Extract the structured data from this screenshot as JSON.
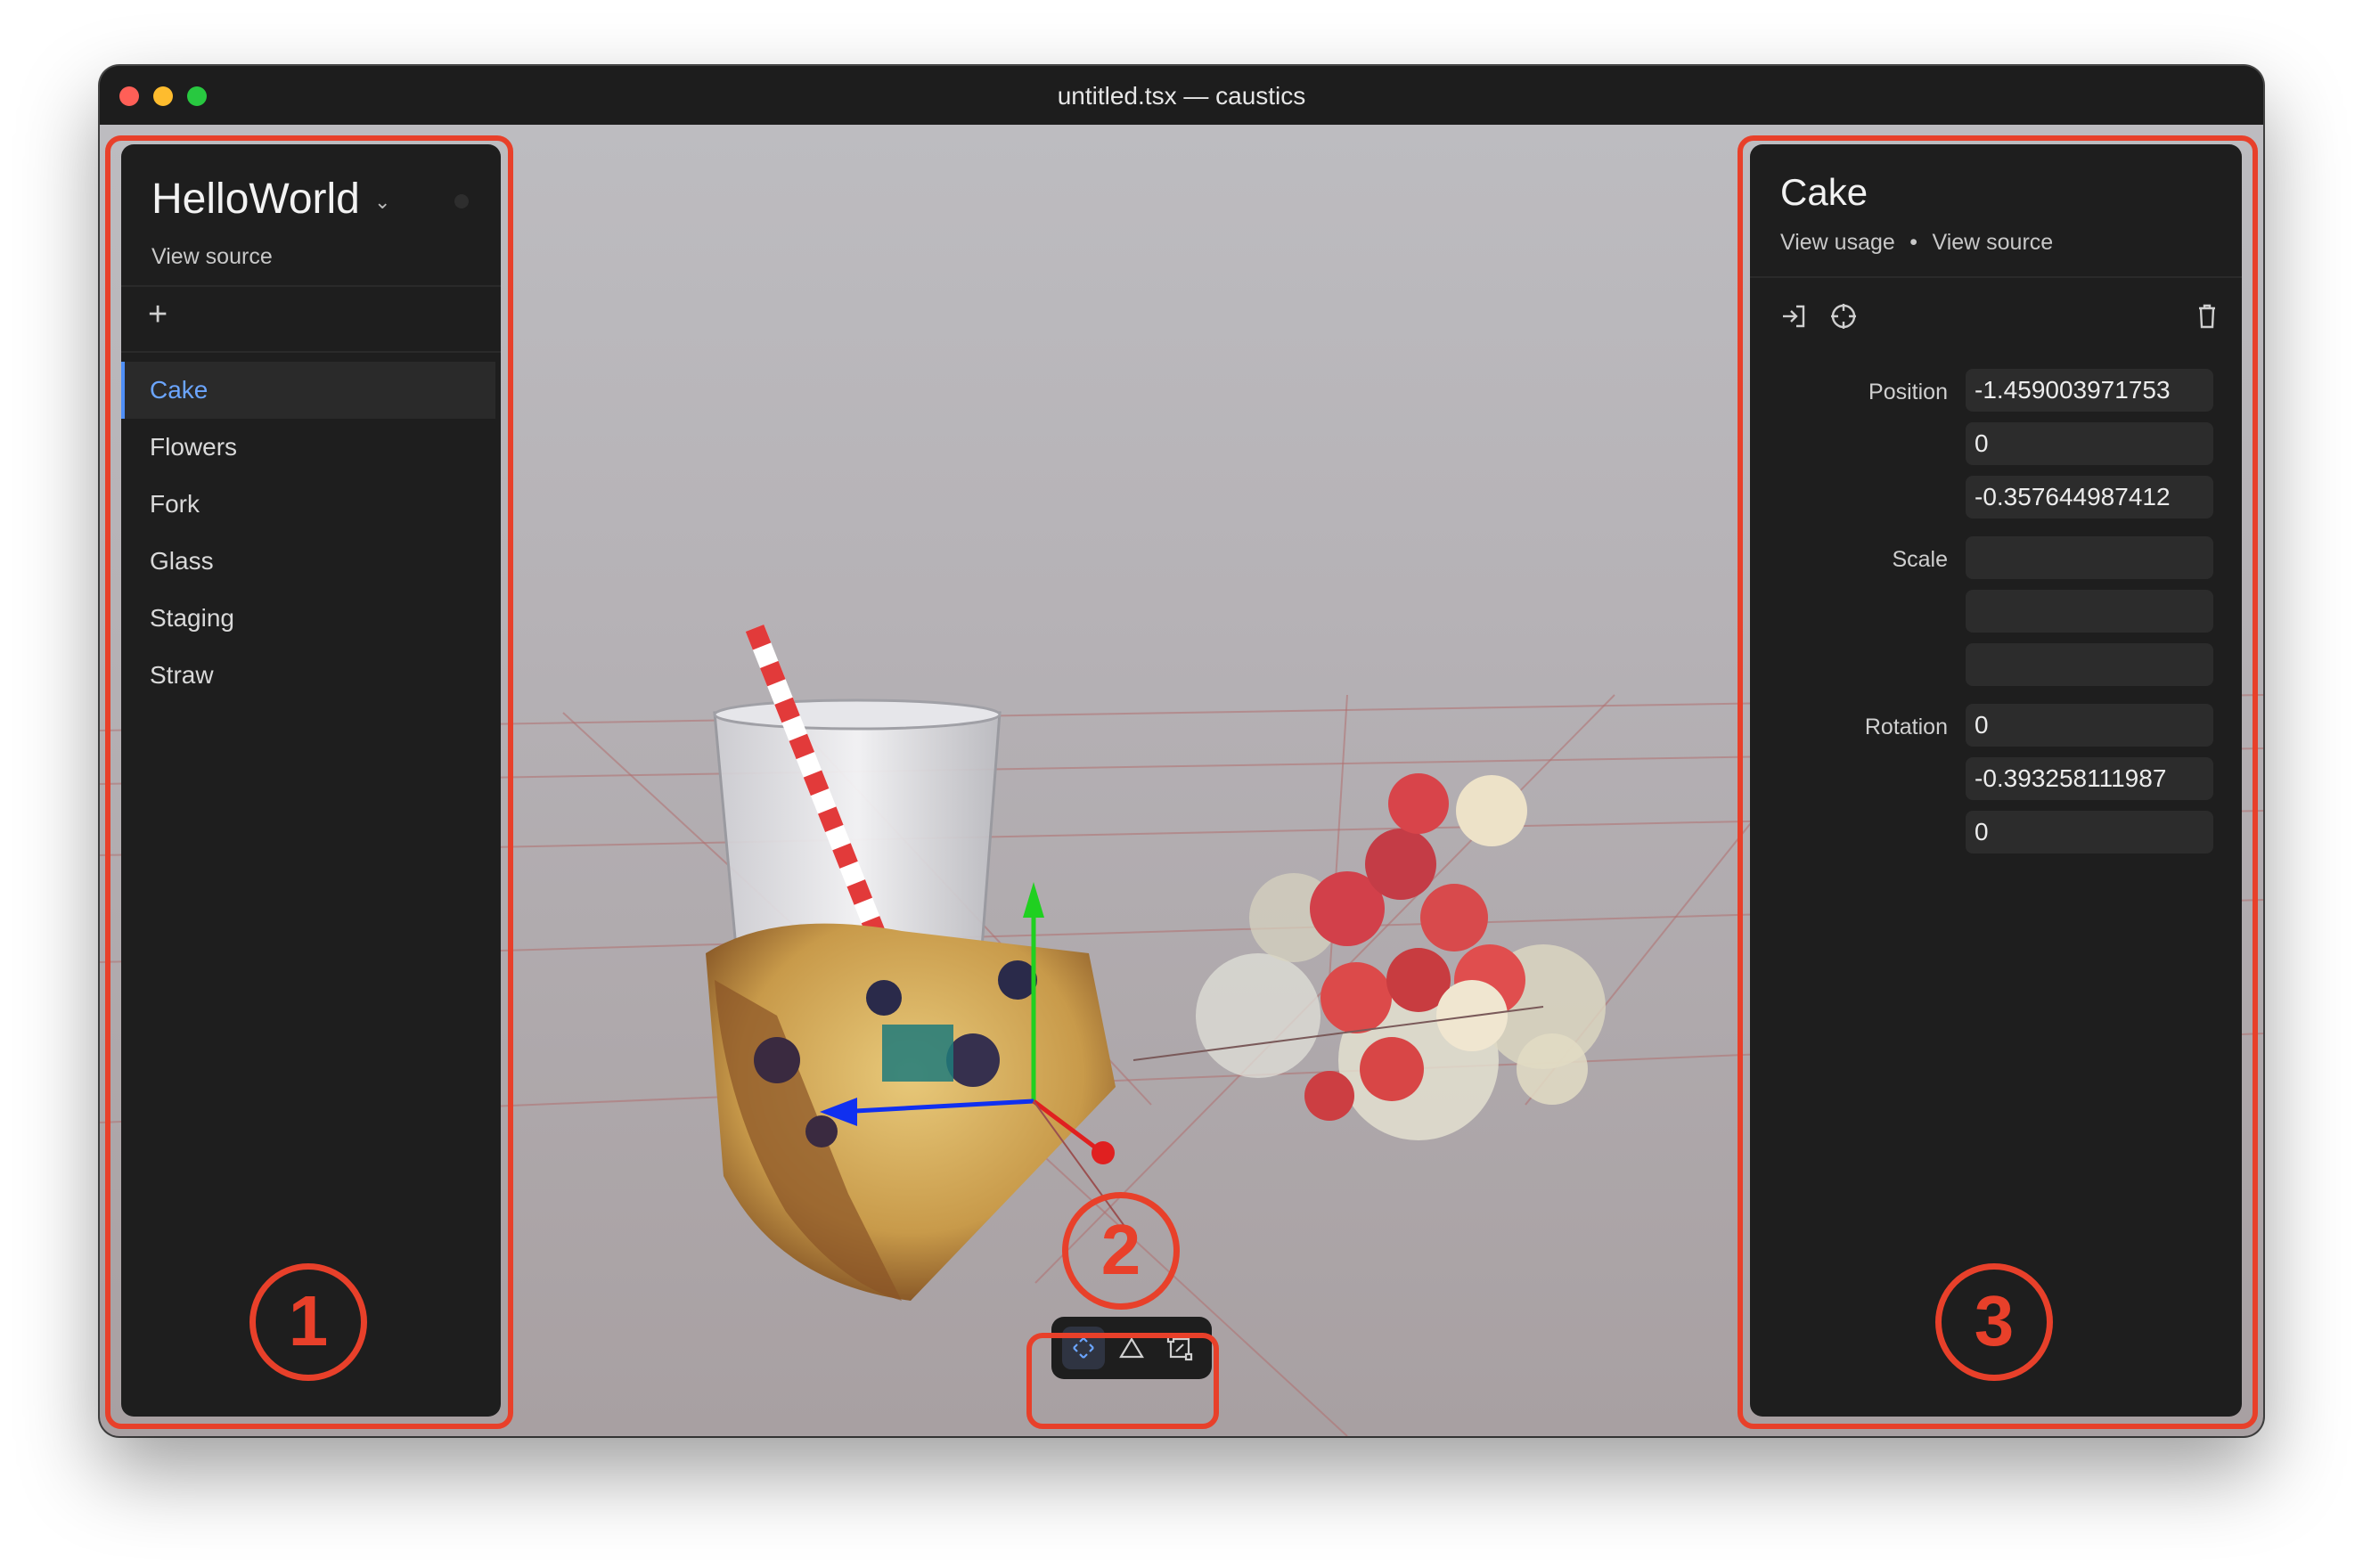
{
  "window": {
    "title": "untitled.tsx — caustics",
    "traffic_lights": {
      "close": "#ff5f57",
      "minimize": "#febc2e",
      "zoom": "#28c840"
    }
  },
  "sidebar": {
    "project_name": "HelloWorld",
    "view_source": "View source",
    "add_icon": "plus-icon",
    "items": [
      {
        "label": "Cake",
        "selected": true
      },
      {
        "label": "Flowers"
      },
      {
        "label": "Fork"
      },
      {
        "label": "Glass"
      },
      {
        "label": "Staging"
      },
      {
        "label": "Straw"
      }
    ],
    "accent": "#6ba5ff"
  },
  "inspector": {
    "title": "Cake",
    "view_usage": "View usage",
    "separator": "•",
    "view_source": "View source",
    "tools": [
      "enter-icon",
      "crosshair-icon",
      "trash-icon"
    ],
    "position_label": "Position",
    "position": [
      "-1.459003971753",
      "0",
      "-0.357644987412"
    ],
    "scale_label": "Scale",
    "scale": [
      "",
      "",
      ""
    ],
    "rotation_label": "Rotation",
    "rotation": [
      "0",
      "-0.393258111987",
      "0"
    ]
  },
  "toolbar": {
    "tools": [
      "translate-icon",
      "rotate-icon",
      "scale-icon"
    ],
    "active_tool": "translate"
  },
  "callouts": [
    "1",
    "2",
    "3"
  ],
  "colors": {
    "callout": "#e8402a",
    "gizmo_x": "#e02020",
    "gizmo_y": "#20d020",
    "gizmo_z": "#1030f0"
  }
}
